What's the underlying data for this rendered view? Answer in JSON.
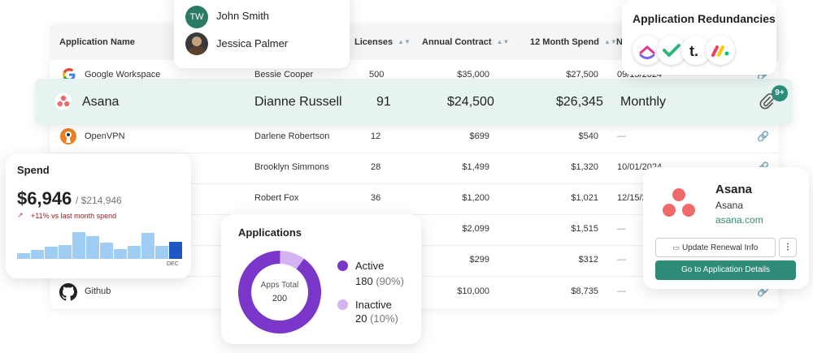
{
  "table": {
    "headers": [
      "Application Name",
      "Licenses",
      "Annual Contract",
      "12 Month Spend",
      "N"
    ],
    "rows": [
      {
        "app": "Google Workspace",
        "owner": "Bessie Cooper",
        "licenses": "500",
        "annual": "$35,000",
        "spend": "$27,500",
        "renewal": "09/15/2024"
      },
      {
        "app": "OpenVPN",
        "owner": "Darlene Robertson",
        "licenses": "12",
        "annual": "$699",
        "spend": "$540",
        "renewal": "—"
      },
      {
        "app": "",
        "owner": "Brooklyn Simmons",
        "licenses": "28",
        "annual": "$1,499",
        "spend": "$1,320",
        "renewal": "10/01/2024"
      },
      {
        "app": "",
        "owner": "Robert Fox",
        "licenses": "36",
        "annual": "$1,200",
        "spend": "$1,021",
        "renewal": "12/15/2"
      },
      {
        "app": "",
        "owner": "",
        "licenses": "",
        "annual": "$2,099",
        "spend": "$1,515",
        "renewal": "—"
      },
      {
        "app": "",
        "owner": "",
        "licenses": "",
        "annual": "$299",
        "spend": "$312",
        "renewal": "—"
      },
      {
        "app": "Github",
        "owner": "",
        "licenses": "",
        "annual": "$10,000",
        "spend": "$8,735",
        "renewal": "—"
      }
    ],
    "highlight": {
      "app": "Asana",
      "owner": "Dianne Russell",
      "licenses": "91",
      "annual": "$24,500",
      "spend": "$26,345",
      "renewal": "Monthly",
      "badge": "9+"
    }
  },
  "owners_popup": {
    "items": [
      {
        "initials": "TW",
        "name": "John Smith"
      },
      {
        "initials": "",
        "name": "Jessica Palmer"
      }
    ]
  },
  "redundancies": {
    "title": "Application Redundancies"
  },
  "spend": {
    "title": "Spend",
    "amount": "$6,946",
    "total": "$214,946",
    "change": "+11% vs last month spend",
    "month_label": "DEC",
    "bars": [
      0.18,
      0.28,
      0.38,
      0.42,
      0.82,
      0.7,
      0.5,
      0.3,
      0.4,
      0.8,
      0.4,
      0.52
    ]
  },
  "applications": {
    "title": "Applications",
    "center_label": "Apps Total",
    "center_value": "200",
    "active_label": "Active",
    "active_value": "180",
    "active_pct": "(90%)",
    "inactive_label": "Inactive",
    "inactive_value": "20",
    "inactive_pct": "(10%)",
    "active_fraction": 0.9,
    "colors": {
      "active": "#7a35c9",
      "inactive": "#d3b3f2"
    }
  },
  "app_detail": {
    "name": "Asana",
    "sub": "Asana",
    "domain": "asana.com",
    "update_button": "Update Renewal Info",
    "details_button": "Go to Application Details"
  }
}
